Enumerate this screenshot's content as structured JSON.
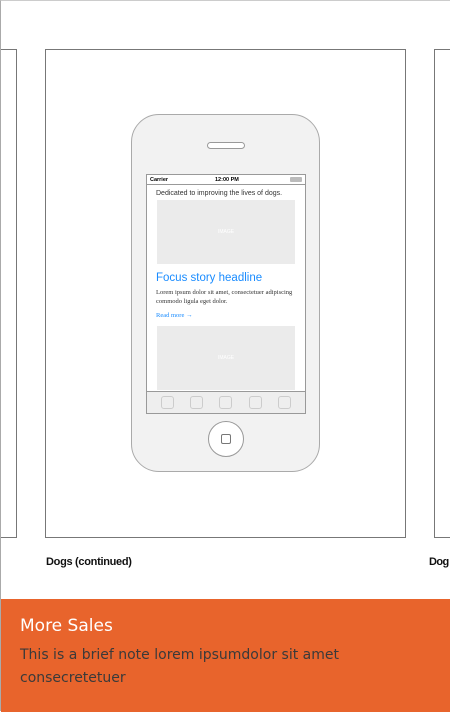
{
  "cards": [
    {
      "caption": "Dogs (continued)"
    },
    {
      "caption": "Dog"
    }
  ],
  "phone": {
    "carrier": "Carrier",
    "time": "12:00 PM",
    "tagline": "Dedicated to improving the lives of dogs.",
    "image_label": "IMAGE",
    "headline": "Focus story headline",
    "body": "Lorem ipsum dolor sit amet, consectetuer adipiscing commodo ligula eget dolor.",
    "read_more": "Read more →"
  },
  "banner": {
    "title": "More Sales",
    "text": "This is a brief note lorem ipsumdolor sit amet consecretetuer",
    "color": "#e8642c"
  }
}
